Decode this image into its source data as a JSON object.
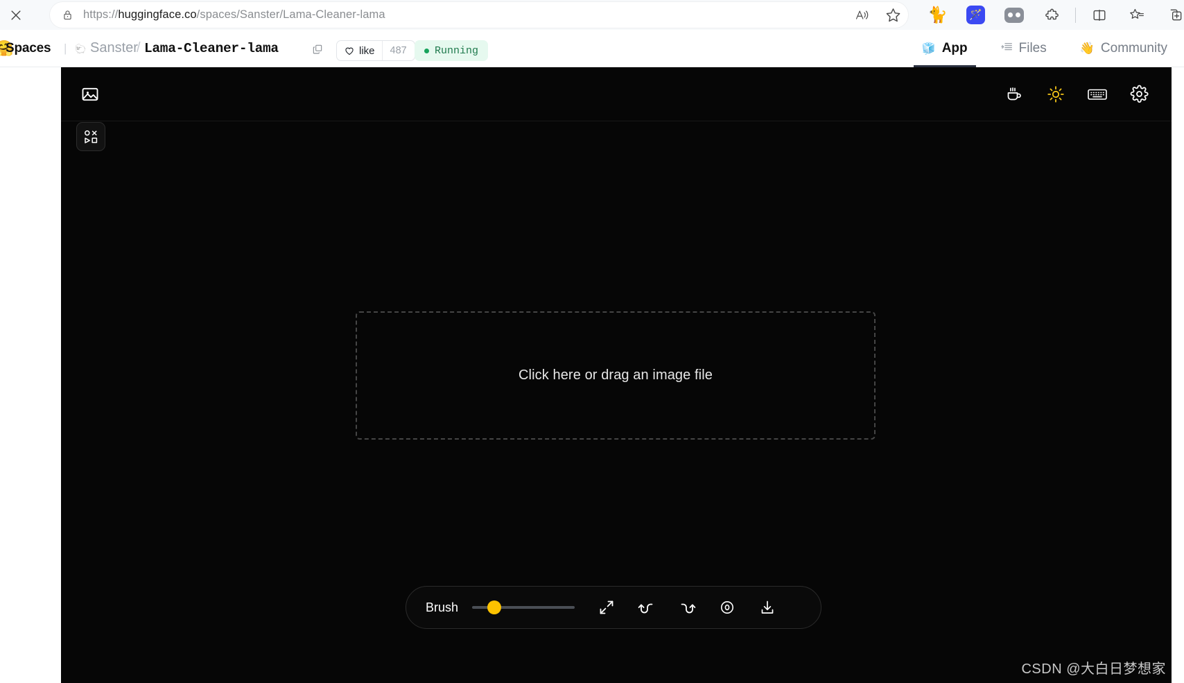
{
  "browser": {
    "close_tab_label": "✕",
    "url_prefix": "https://",
    "url_domain": "huggingface.co",
    "url_path": "/spaces/Sanster/Lama-Cleaner-lama",
    "url_full": "https://huggingface.co/spaces/Sanster/Lama-Cleaner-lama",
    "read_aloud": "read-aloud-icon",
    "favorite": "star-icon",
    "extensions": [
      {
        "name": "cat-extension",
        "glyph": "🐈"
      },
      {
        "name": "magic-wand-extension",
        "glyph": "🪄"
      },
      {
        "name": "split-pill-extension",
        "glyph": "⬭"
      },
      {
        "name": "puzzle-extensions",
        "glyph": "⛶"
      },
      {
        "name": "split-screen",
        "glyph": "◫"
      },
      {
        "name": "collections",
        "glyph": "☆"
      },
      {
        "name": "add-tab-group",
        "glyph": "⧉"
      }
    ]
  },
  "hf_header": {
    "logo": "huggingface-logo",
    "spaces_label": "Spaces",
    "owner": "Sanster",
    "slash": "/",
    "repo": "Lama-Cleaner-lama",
    "copy_icon": "copy-icon",
    "like_label": "like",
    "like_count": "487",
    "status_label": "Running",
    "status_color": "#17a35c",
    "tabs": [
      {
        "label": "App",
        "icon": "cube-icon",
        "glyph": "🧊",
        "active": true
      },
      {
        "label": "Files",
        "icon": "files-icon",
        "glyph": "▤",
        "active": false
      },
      {
        "label": "Community",
        "icon": "wave-hand-icon",
        "glyph": "👋",
        "active": false
      }
    ]
  },
  "app": {
    "background_color": "#060606",
    "toolbar": {
      "image_icon": "image-icon",
      "right_icons": [
        {
          "name": "coffee-icon",
          "color": "#ffffff"
        },
        {
          "name": "sun-theme-icon",
          "color": "#f5c518"
        },
        {
          "name": "keyboard-shortcuts-icon",
          "color": "#ffffff"
        },
        {
          "name": "settings-gear-icon",
          "color": "#ffffff"
        }
      ]
    },
    "shortcut_button": "shapes-shortcut-button",
    "dropzone_text": "Click here or drag an image file",
    "bottom_bar": {
      "brush_label": "Brush",
      "slider_value_pct": 15,
      "slider_thumb_color": "#fcc200",
      "icons": [
        {
          "name": "expand-fullscreen-icon"
        },
        {
          "name": "undo-icon"
        },
        {
          "name": "redo-icon"
        },
        {
          "name": "eye-toggle-original-icon"
        },
        {
          "name": "download-icon"
        }
      ]
    }
  },
  "watermark": "CSDN @大白日梦想家"
}
